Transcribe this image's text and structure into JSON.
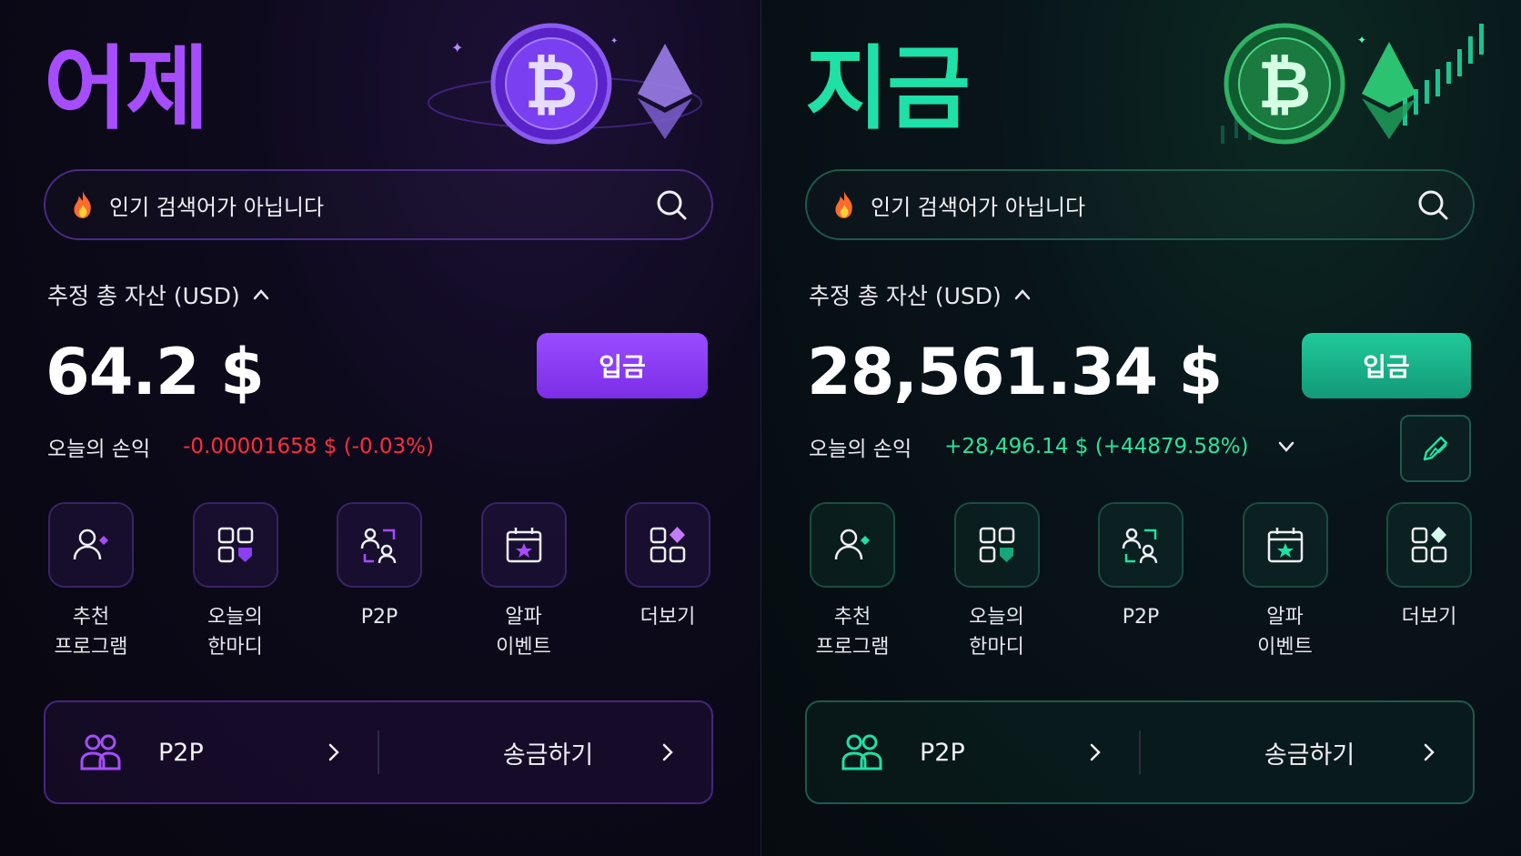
{
  "panels": {
    "yesterday": {
      "title": "어제",
      "accent": "#a64dff",
      "search": {
        "placeholder": "인기 검색어가 아닙니다"
      },
      "asset_label": "추정 총 자산 (USD)",
      "asset_value": "64.2 $",
      "deposit_label": "입금",
      "pnl_label": "오늘의 손익",
      "pnl_value": "-0.00001658 $ (-0.03%)",
      "shortcuts": [
        {
          "label": "추천\n프로그램",
          "icon": "user-plus-icon"
        },
        {
          "label": "오늘의\n한마디",
          "icon": "grid-icon"
        },
        {
          "label": "P2P",
          "icon": "p2p-users-icon"
        },
        {
          "label": "알파\n이벤트",
          "icon": "calendar-star-icon"
        },
        {
          "label": "더보기",
          "icon": "more-grid-icon"
        }
      ],
      "bottom": {
        "p2p_label": "P2P",
        "send_label": "송금하기"
      }
    },
    "now": {
      "title": "지금",
      "accent": "#1fe0a6",
      "search": {
        "placeholder": "인기 검색어가 아닙니다"
      },
      "asset_label": "추정 총 자산 (USD)",
      "asset_value": "28,561.34 $",
      "deposit_label": "입금",
      "pnl_label": "오늘의 손익",
      "pnl_value": "+28,496.14 $ (+44879.58%)",
      "shortcuts": [
        {
          "label": "추천\n프로그램",
          "icon": "user-plus-icon"
        },
        {
          "label": "오늘의\n한마디",
          "icon": "grid-icon"
        },
        {
          "label": "P2P",
          "icon": "p2p-users-icon"
        },
        {
          "label": "알파\n이벤트",
          "icon": "calendar-star-icon"
        },
        {
          "label": "더보기",
          "icon": "more-grid-icon"
        }
      ],
      "bottom": {
        "p2p_label": "P2P",
        "send_label": "송금하기"
      }
    }
  }
}
